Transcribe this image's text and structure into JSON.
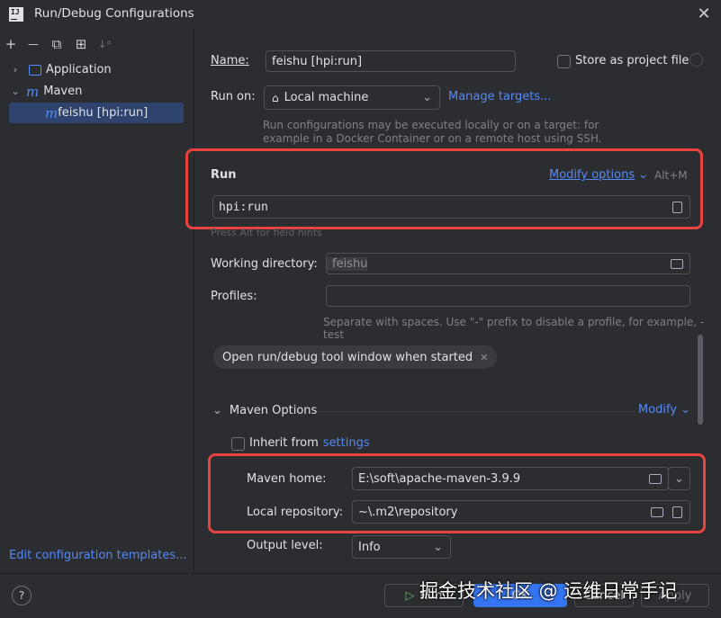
{
  "window": {
    "title": "Run/Debug Configurations",
    "logo_text": "IJ"
  },
  "toolbar": {
    "add": "+",
    "remove": "—",
    "copy": "⧉",
    "folder": "⊞",
    "sort": "↓ᵃ"
  },
  "tree": {
    "application": "Application",
    "maven": "Maven",
    "maven_glyph": "m",
    "feishu": "feishu [hpi:run]"
  },
  "left_footer": {
    "edit_templates": "Edit configuration templates..."
  },
  "form": {
    "name_label": "Name:",
    "name_value": "feishu [hpi:run]",
    "store_label": "Store as project file",
    "run_on_label": "Run on:",
    "run_on_value": "Local machine",
    "manage_targets": "Manage targets...",
    "run_on_hint_1": "Run configurations may be executed locally or on a target: for",
    "run_on_hint_2": "example in a Docker Container or on a remote host using SSH.",
    "run_section": "Run",
    "modify_options": "Modify options",
    "modify_shortcut": "Alt+M",
    "command_value": "hpi:run",
    "field_hint": "Press Alt for field hints",
    "working_dir_label": "Working directory:",
    "working_dir_value": "feishu",
    "profiles_label": "Profiles:",
    "profiles_value": "",
    "profiles_hint": "Separate with spaces. Use \"-\" prefix to disable a profile, for example, -test",
    "tool_window_tag": "Open run/debug tool window when started",
    "maven_options": "Maven Options",
    "modify": "Modify",
    "inherit_label": "Inherit from",
    "settings_link": "settings",
    "maven_home_label": "Maven home:",
    "maven_home_value": "E:\\soft\\apache-maven-3.9.9",
    "local_repo_label": "Local repository:",
    "local_repo_value": "~\\.m2\\repository",
    "output_level_label": "Output level:",
    "output_level_value": "Info"
  },
  "buttons": {
    "help": "?",
    "run": "Run",
    "ok": "OK",
    "cancel": "Cancel",
    "apply": "Apply"
  },
  "watermark": "掘金技术社区 @ 运维日常手记",
  "colors": {
    "background": "#2b2d30",
    "accent": "#548af7",
    "highlight_box": "#e8433f",
    "selection": "#2e436e"
  }
}
